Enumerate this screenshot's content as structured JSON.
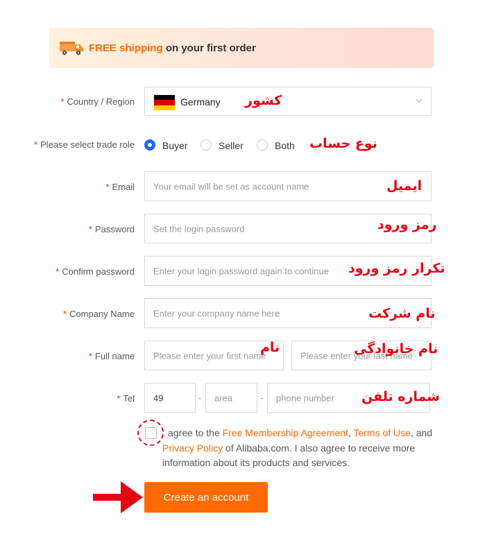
{
  "banner": {
    "highlight": "FREE shipping",
    "text": " on your first order",
    "icon": "truck-icon"
  },
  "form": {
    "country": {
      "label": "Country / Region",
      "value": "Germany",
      "annotation": "کشور",
      "flag_colors": [
        "#000000",
        "#dd0000",
        "#ffce00"
      ]
    },
    "trade_role": {
      "label": "Please select trade role",
      "options": [
        "Buyer",
        "Seller",
        "Both"
      ],
      "selected": "Buyer",
      "annotation": "نوع حساب"
    },
    "email": {
      "label": "Email",
      "placeholder": "Your email will be set as account name",
      "annotation": "ایمیل"
    },
    "password": {
      "label": "Password",
      "placeholder": "Set the login password",
      "annotation": "رمز ورود"
    },
    "confirm_password": {
      "label": "Confirm password",
      "placeholder": "Enter your login password again to continue",
      "annotation": "تکرار رمز ورود"
    },
    "company": {
      "label": "Company Name",
      "placeholder": "Enter your company name here",
      "annotation": "نام شرکت"
    },
    "full_name": {
      "label": "Full name",
      "first_placeholder": "Please enter your first name",
      "last_placeholder": "Please enter your last name",
      "first_annotation": "نام",
      "last_annotation": "نام خانوادگی"
    },
    "tel": {
      "label": "Tel",
      "country_code": "49",
      "area_placeholder": "area",
      "phone_placeholder": "phone number",
      "annotation": "شماره تلفن",
      "separator": "-"
    },
    "required_mark": "*"
  },
  "agreement": {
    "prefix": "agree to the ",
    "link1": "Free Membership Agreement",
    "sep1": ", ",
    "link2": "Terms of Use",
    "sep2": ", and ",
    "link3": "Privacy Policy",
    "suffix": " of Alibaba.com. I also agree to receive more information about its products and services."
  },
  "submit": {
    "label": "Create an account"
  },
  "colors": {
    "accent": "#ff6a00",
    "annotation_red": "#e30613",
    "radio_blue": "#1a66ff"
  }
}
